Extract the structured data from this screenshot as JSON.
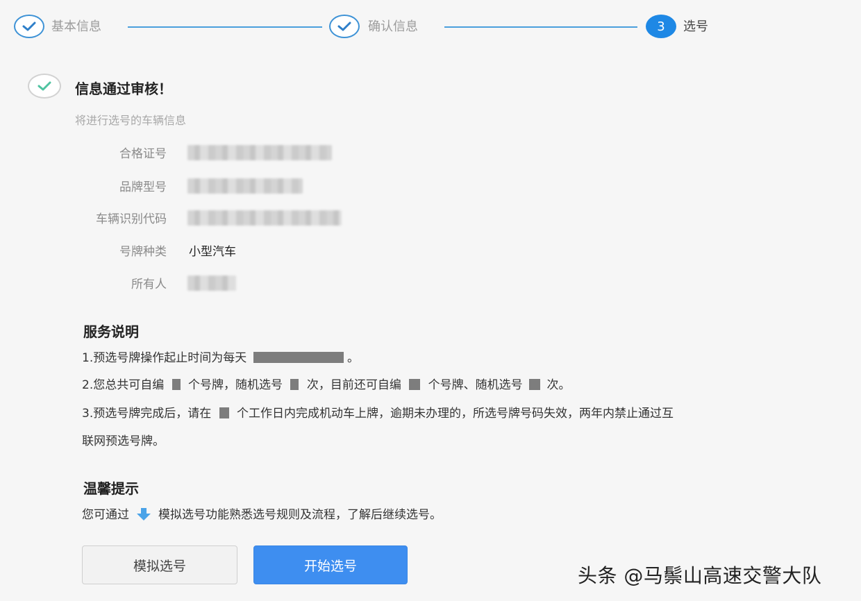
{
  "steps": [
    {
      "label": "基本信息",
      "state": "done"
    },
    {
      "label": "确认信息",
      "state": "done"
    },
    {
      "label": "选号",
      "state": "active",
      "number": "3"
    }
  ],
  "result": {
    "title": "信息通过审核！",
    "subtitle": "将进行选号的车辆信息"
  },
  "vehicle_info": [
    {
      "label": "合格证号",
      "value": "",
      "redacted": true
    },
    {
      "label": "品牌型号",
      "value": "",
      "redacted": true
    },
    {
      "label": "车辆识别代码",
      "value": "",
      "redacted": true
    },
    {
      "label": "号牌种类",
      "value": "小型汽车",
      "redacted": false
    },
    {
      "label": "所有人",
      "value": "",
      "redacted": true
    }
  ],
  "service": {
    "title": "服务说明",
    "line1_a": "1.预选号牌操作起止时间为每天",
    "line1_b": "。",
    "line2_a": "2.您总共可自编",
    "line2_b": "个号牌，随机选号",
    "line2_c": "次，目前还可自编",
    "line2_d": "个号牌、随机选号",
    "line2_e": "次。",
    "line3_a": "3.预选号牌完成后，请在",
    "line3_b": "个工作日内完成机动车上牌，逾期未办理的，所选号牌号码失效，两年内禁止通过互",
    "line3_c": "联网预选号牌。"
  },
  "tips": {
    "title": "温馨提示",
    "text_a": "您可通过",
    "text_b": "模拟选号功能熟悉选号规则及流程，了解后继续选号。"
  },
  "buttons": {
    "simulate": "模拟选号",
    "start": "开始选号"
  },
  "watermark": "头条 @马鬃山高速交警大队",
  "colors": {
    "accent": "#1e88e5",
    "primary_button": "#3e8ef0",
    "check": "#4fc3a1"
  }
}
